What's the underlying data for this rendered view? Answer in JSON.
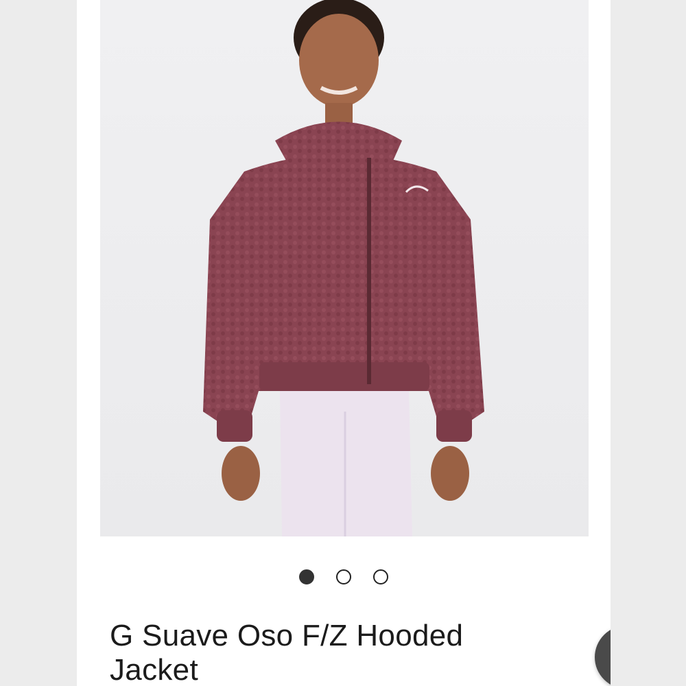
{
  "product": {
    "title": "G Suave Oso F/Z Hooded Jacket",
    "image_alt": "Girl wearing a plush maroon hooded full-zip jacket with light lavender leggings",
    "jacket_color": "#8a4452",
    "leggings_color": "#ece3ee"
  },
  "gallery": {
    "dots": [
      {
        "state": "active"
      },
      {
        "state": "inactive"
      },
      {
        "state": "inactive"
      }
    ]
  },
  "help_button": {
    "icon": "question-mark-icon",
    "glyph": "?"
  },
  "colors": {
    "card_bg": "#ffffff",
    "side_bg": "#ececec",
    "help_bg": "#4a4a4a"
  }
}
